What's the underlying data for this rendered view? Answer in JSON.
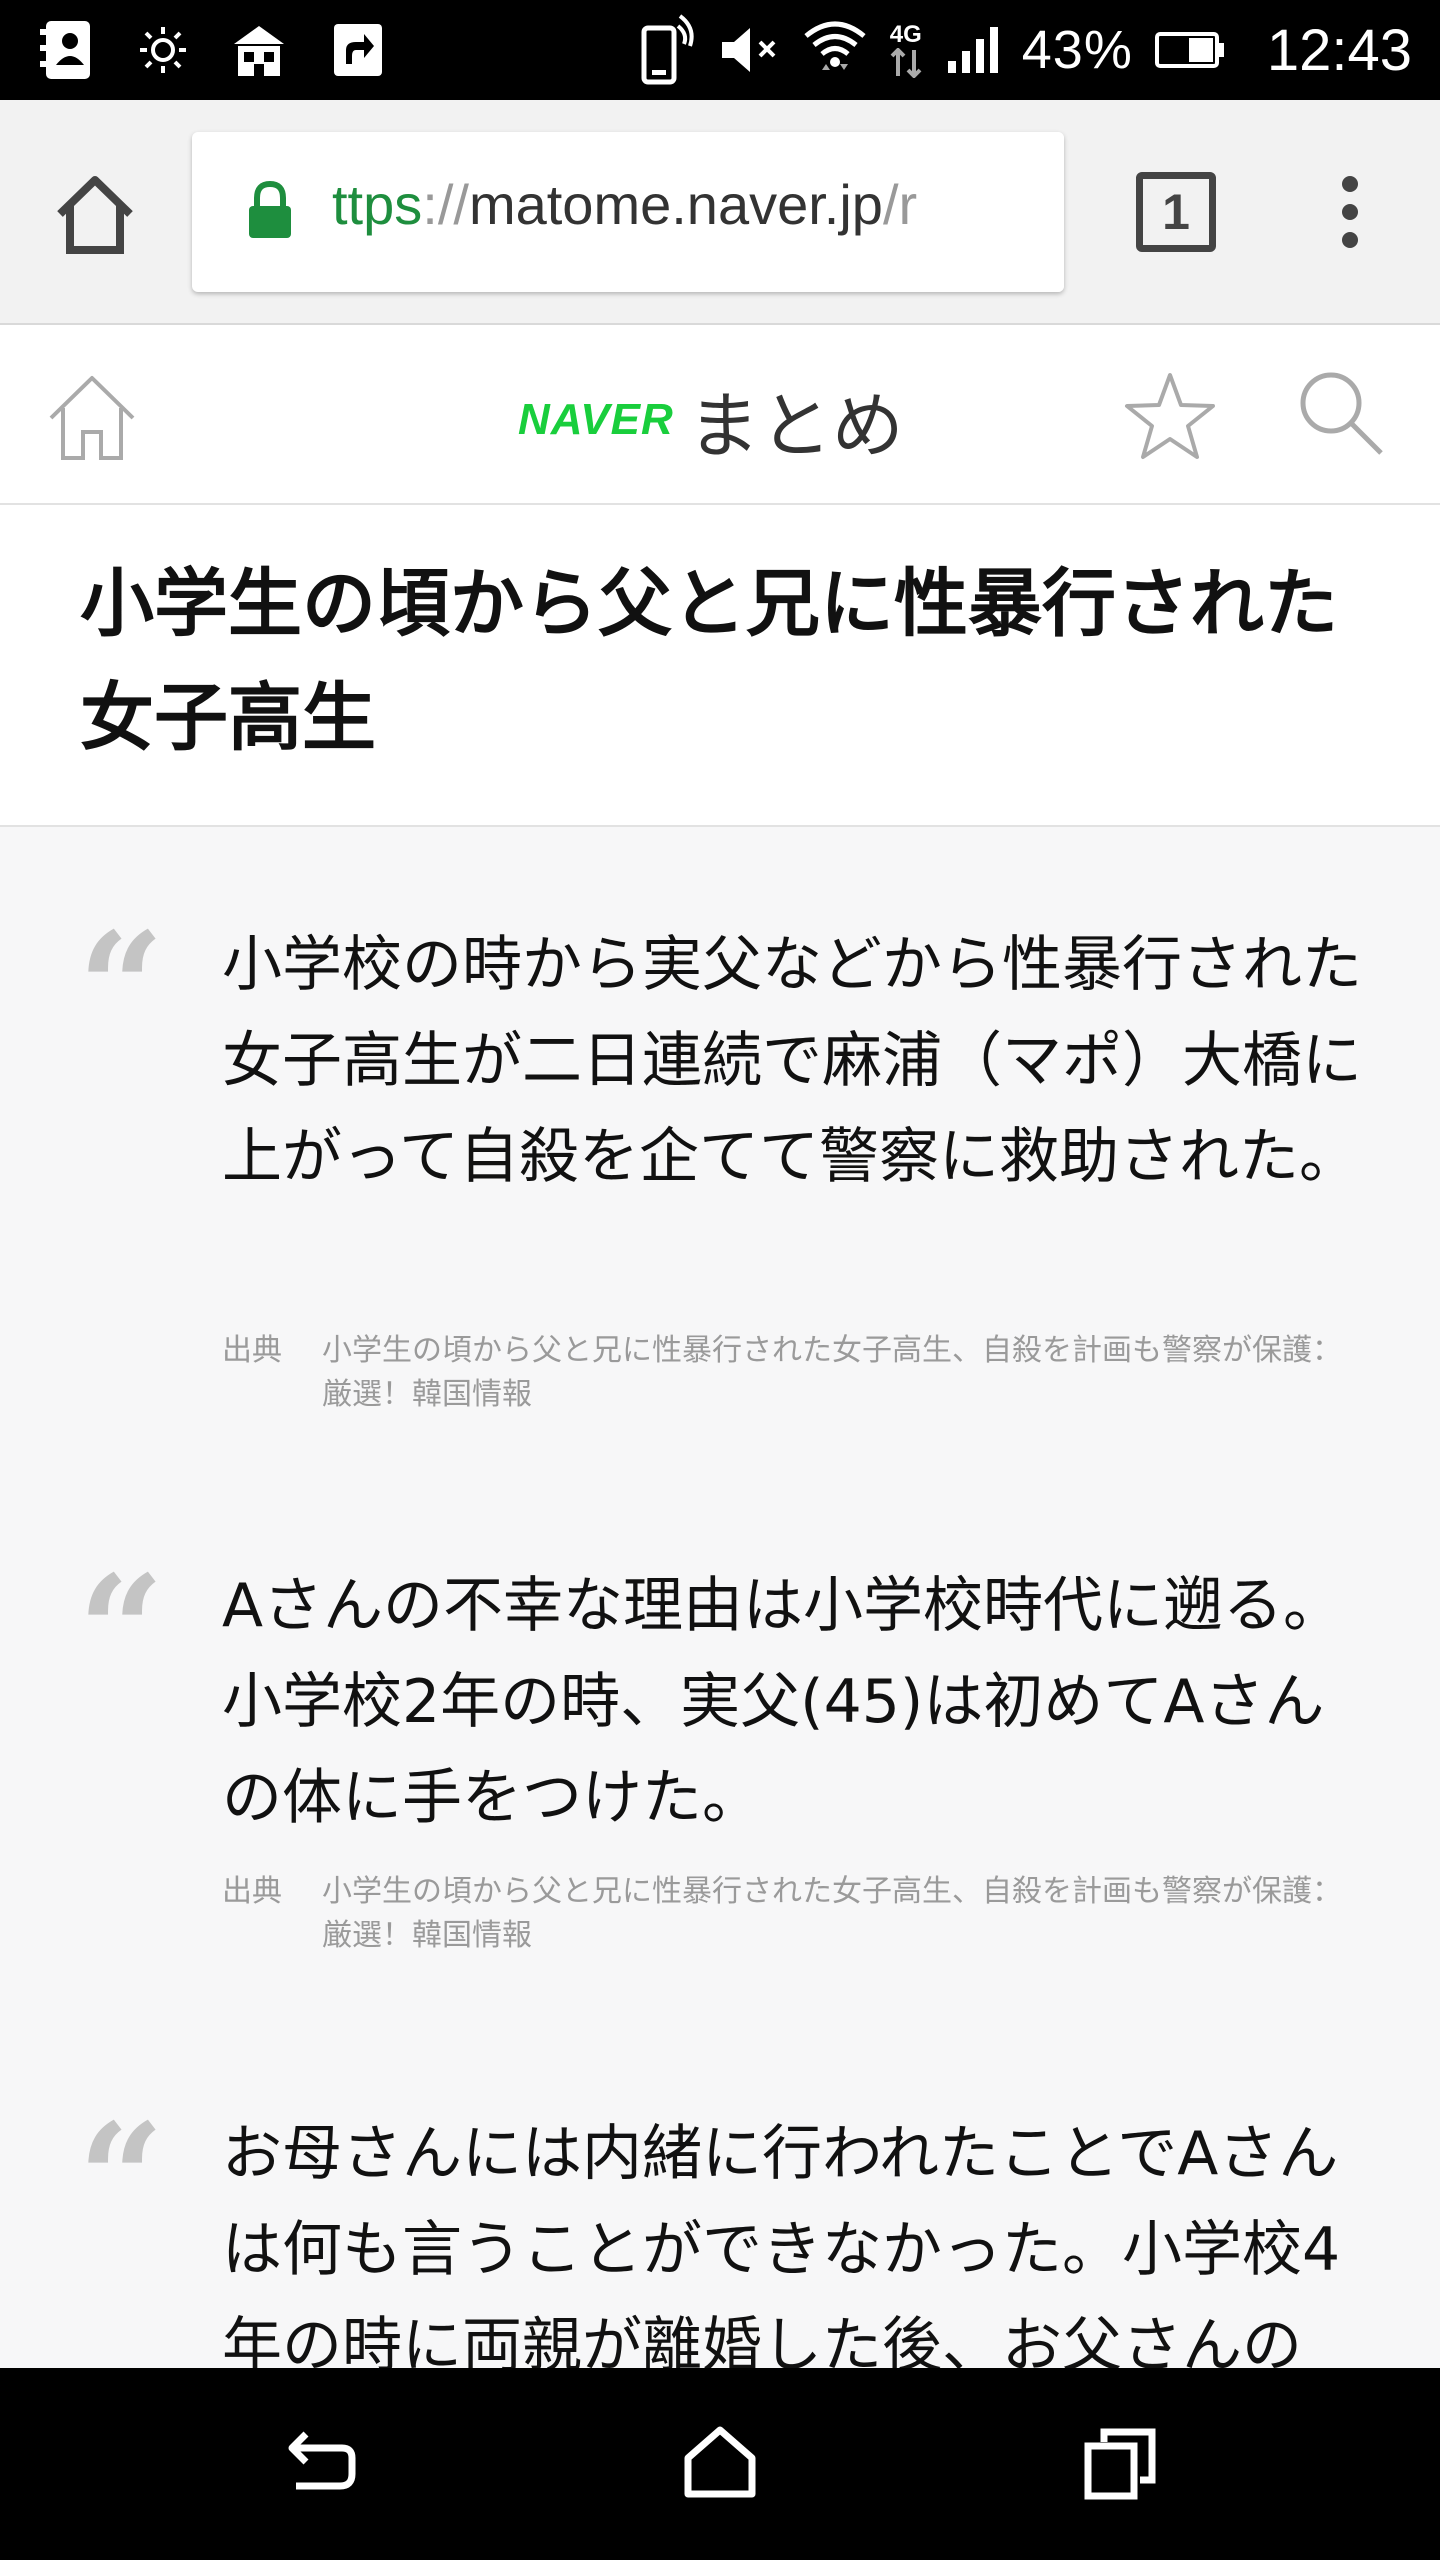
{
  "status_bar": {
    "battery_percent": "43%",
    "time": "12:43",
    "network_type": "4G",
    "icons": [
      "contacts-icon",
      "brightness-icon",
      "store-icon",
      "share-icon",
      "vibrate-icon",
      "mute-icon",
      "wifi-icon",
      "network-4g-icon",
      "signal-icon",
      "battery-icon"
    ]
  },
  "browser": {
    "url_scheme": "ttps",
    "url_sep": "://",
    "url_host": "matome.naver.jp",
    "url_path": "/r",
    "tab_count": "1",
    "accent_color": "#1e8e3e"
  },
  "site_header": {
    "logo_brand": "NAVER",
    "logo_service": "まとめ",
    "brand_color": "#19ce3c"
  },
  "article": {
    "title": "小学生の頃から父と兄に性暴行された女子高生",
    "quotes": [
      {
        "text": "小学校の時から実父などから性暴行された女子高生が二日連続で麻浦（マポ）大橋に上がって自殺を企てて警察に救助された。",
        "source_label": "出典",
        "source": "小学生の頃から父と兄に性暴行された女子高生、自殺を計画も警察が保護：厳選！韓国情報"
      },
      {
        "text": "Aさんの不幸な理由は小学校時代に遡る。小学校2年の時、実父(45)は初めてAさんの体に手をつけた。",
        "source_label": "出典",
        "source": "小学生の頃から父と兄に性暴行された女子高生、自殺を計画も警察が保護：厳選！韓国情報"
      },
      {
        "text": "お母さんには内緒に行われたことでAさんは何も言うことができなかった。小学校4年の時に両親が離婚した後、お父さんの"
      }
    ]
  }
}
